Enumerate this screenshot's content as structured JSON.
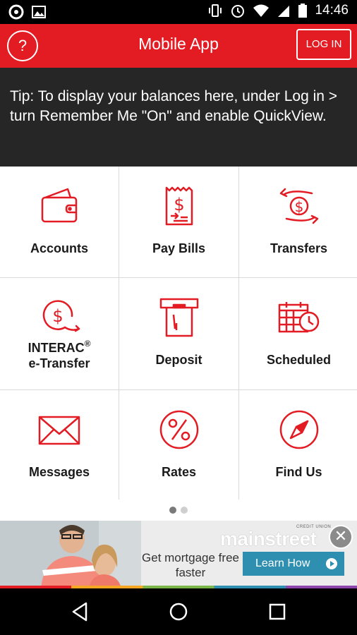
{
  "status_bar": {
    "time": "14:46"
  },
  "app_bar": {
    "title": "Mobile App",
    "help_label": "?",
    "login_label": "LOG IN"
  },
  "tip": {
    "text": "Tip: To display your balances here, under Log in > turn Remember Me \"On\" and enable QuickView."
  },
  "tiles": [
    {
      "label": "Accounts",
      "icon": "wallet-icon"
    },
    {
      "label": "Pay Bills",
      "icon": "bill-icon"
    },
    {
      "label": "Transfers",
      "icon": "transfer-icon"
    },
    {
      "label_line1": "INTERAC",
      "label_sup": "®",
      "label_line2": "e-Transfer",
      "icon": "etransfer-icon"
    },
    {
      "label": "Deposit",
      "icon": "deposit-icon"
    },
    {
      "label": "Scheduled",
      "icon": "calendar-clock-icon"
    },
    {
      "label": "Messages",
      "icon": "envelope-icon"
    },
    {
      "label": "Rates",
      "icon": "percent-icon"
    },
    {
      "label": "Find Us",
      "icon": "compass-icon"
    }
  ],
  "pager": {
    "pages": 2,
    "current": 1
  },
  "ad": {
    "brand": "mainstreet",
    "brand_sub": "CREDIT UNION",
    "headline": "Get mortgage free faster",
    "button_label": "Learn How",
    "close_label": "✕"
  },
  "colors": {
    "accent": "#e31b23",
    "tip_bg": "#262626",
    "ad_button": "#2f8fb0"
  }
}
